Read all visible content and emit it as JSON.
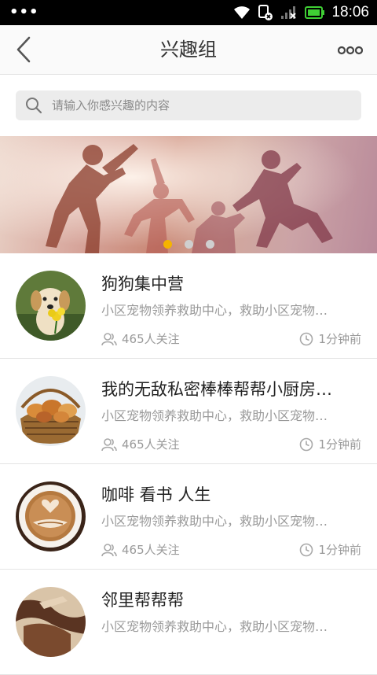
{
  "status_bar": {
    "time": "18:06",
    "icons": [
      "dots-menu-icon",
      "wifi-icon",
      "sim-x-icon",
      "signal-x-icon",
      "battery-icon"
    ]
  },
  "nav": {
    "title": "兴趣组",
    "back_icon": "chevron-left-icon",
    "more_icon": "more-dots-icon"
  },
  "search": {
    "placeholder": "请输入你感兴趣的内容",
    "value": ""
  },
  "banner": {
    "slide_count": 3,
    "active_index": 0,
    "colors": {
      "active": "#f5b400",
      "inactive": "#cfcfcf"
    }
  },
  "groups": [
    {
      "title": "狗狗集中营",
      "desc": "小区宠物领养救助中心，救助小区宠物…",
      "followers": "465人关注",
      "time": "1分钟前",
      "avatar": "puppy-with-flowers"
    },
    {
      "title": "我的无敌私密棒棒帮帮小厨房…",
      "desc": "小区宠物领养救助中心，救助小区宠物…",
      "followers": "465人关注",
      "time": "1分钟前",
      "avatar": "bread-basket"
    },
    {
      "title": "咖啡 看书 人生",
      "desc": "小区宠物领养救助中心，救助小区宠物…",
      "followers": "465人关注",
      "time": "1分钟前",
      "avatar": "coffee-latte-art"
    },
    {
      "title": "邻里帮帮帮",
      "desc": "小区宠物领养救助中心，救助小区宠物…",
      "followers": "",
      "time": "",
      "avatar": "hands"
    }
  ],
  "colors": {
    "accent": "#f5b400",
    "title_text": "#222222",
    "secondary_text": "#9a9a9a"
  }
}
